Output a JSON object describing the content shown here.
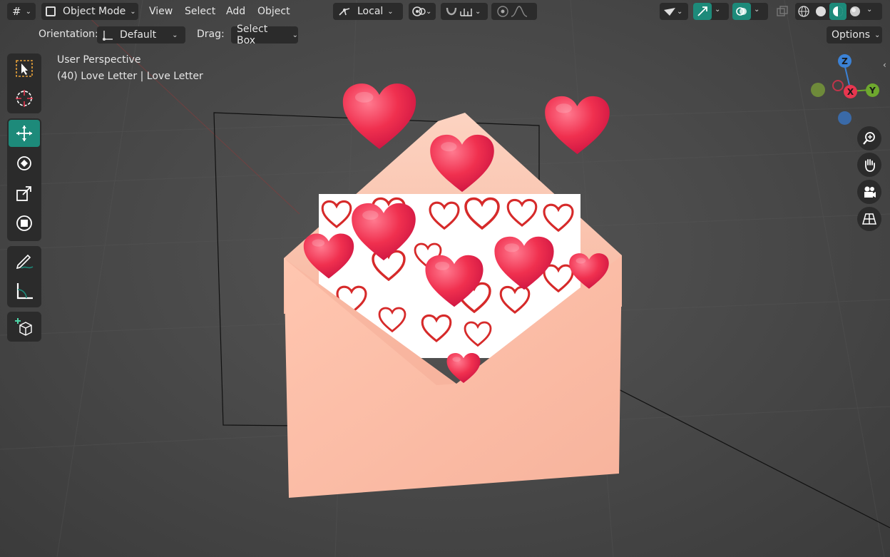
{
  "header": {
    "mode_label": "Object Mode",
    "menus": [
      "View",
      "Select",
      "Add",
      "Object"
    ],
    "pivot_label": "Local"
  },
  "tool_settings": {
    "orientation_label": "Orientation:",
    "orientation_value": "Default",
    "drag_label": "Drag:",
    "drag_value": "Select Box",
    "options_label": "Options"
  },
  "overlay": {
    "view_name": "User Perspective",
    "object_info": "(40) Love Letter | Love Letter"
  },
  "gizmo": {
    "z_label": "Z",
    "y_label": "Y",
    "x_label": "X",
    "colors": {
      "x": "#e8364f",
      "y": "#6ea82e",
      "z": "#3b82d6"
    }
  },
  "toolbar": {
    "tools": [
      "select-box",
      "cursor",
      "move",
      "rotate",
      "scale",
      "transform",
      "annotate",
      "measure",
      "add-cube"
    ],
    "active_tool": "move"
  },
  "colors": {
    "accent": "#1d8a7a",
    "envelope": "#fbbea7",
    "heart": "#e8264f"
  }
}
